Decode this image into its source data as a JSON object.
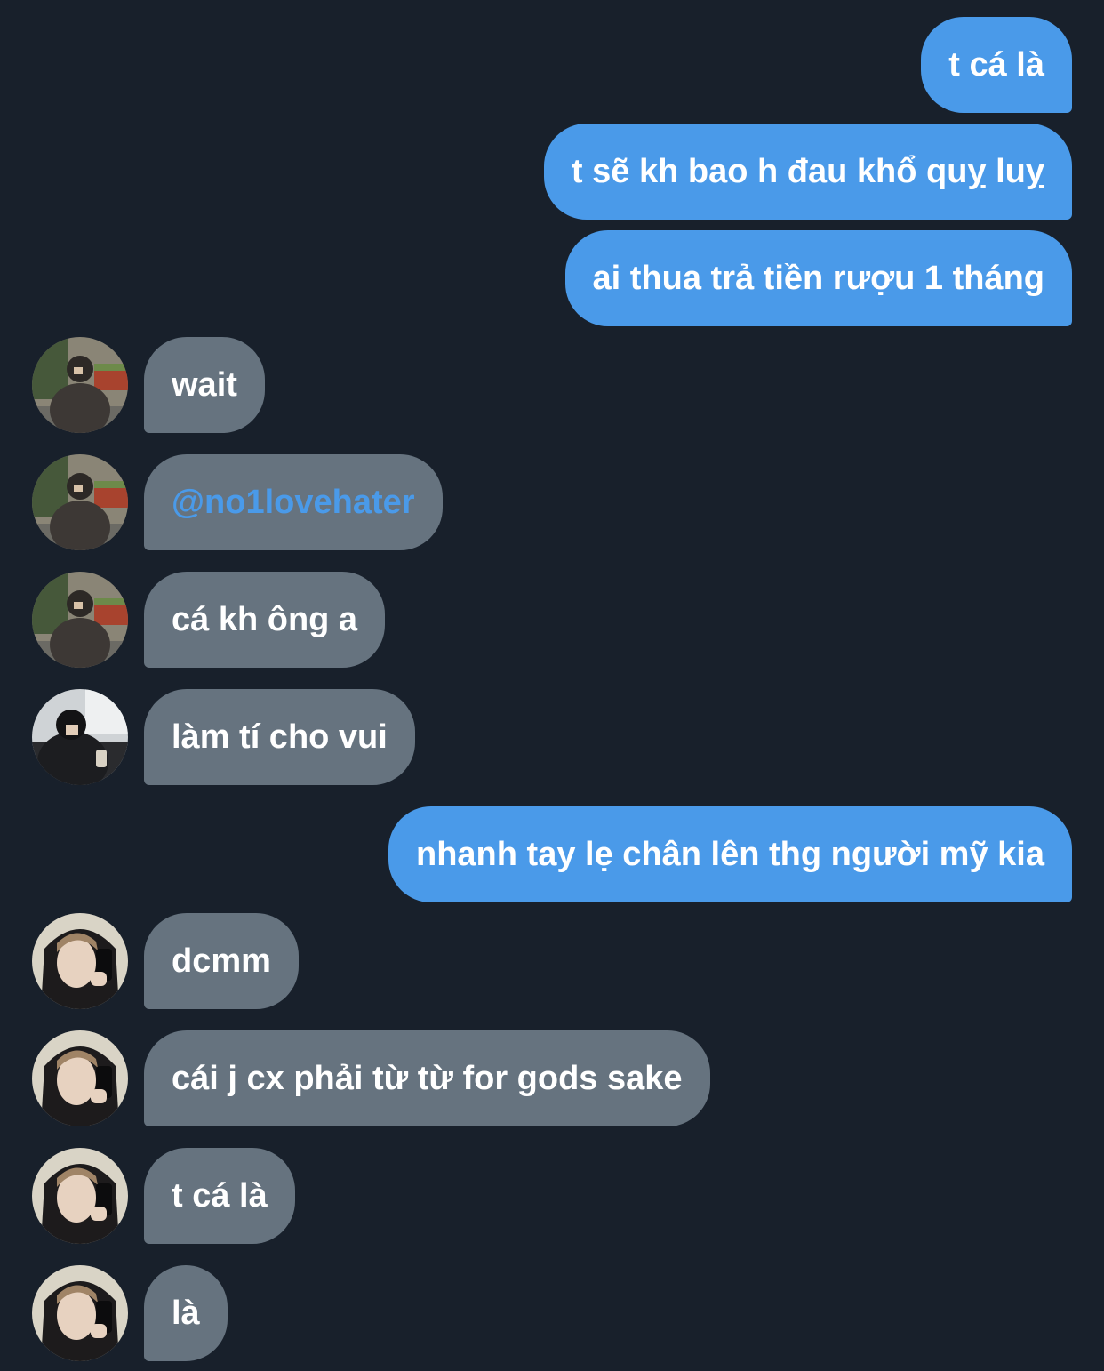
{
  "messages": [
    {
      "id": "m1",
      "direction": "outgoing",
      "text": "t cá là"
    },
    {
      "id": "m2",
      "direction": "outgoing",
      "text": "t sẽ kh bao h đau khổ quỵ luỵ"
    },
    {
      "id": "m3",
      "direction": "outgoing",
      "text": "ai thua trả tiền rượu 1 tháng"
    },
    {
      "id": "m4",
      "direction": "incoming",
      "avatar": "user-a",
      "text": "wait"
    },
    {
      "id": "m5",
      "direction": "incoming",
      "avatar": "user-a",
      "text": "@no1lovehater",
      "is_mention": true
    },
    {
      "id": "m6",
      "direction": "incoming",
      "avatar": "user-a",
      "text": "cá kh ông a"
    },
    {
      "id": "m7",
      "direction": "incoming",
      "avatar": "user-b",
      "text": "làm tí cho vui"
    },
    {
      "id": "m8",
      "direction": "outgoing",
      "text": "nhanh tay lẹ chân lên thg người mỹ kia"
    },
    {
      "id": "m9",
      "direction": "incoming",
      "avatar": "user-c",
      "text": "dcmm"
    },
    {
      "id": "m10",
      "direction": "incoming",
      "avatar": "user-c",
      "text": "cái j cx phải từ từ for gods sake"
    },
    {
      "id": "m11",
      "direction": "incoming",
      "avatar": "user-c",
      "text": "t cá là"
    },
    {
      "id": "m12",
      "direction": "incoming",
      "avatar": "user-c",
      "text": "là"
    }
  ],
  "colors": {
    "background": "#18202b",
    "outgoing_bubble": "#4a9ae9",
    "incoming_bubble": "#66737f",
    "text": "#ffffff",
    "mention": "#4a9ae9"
  }
}
